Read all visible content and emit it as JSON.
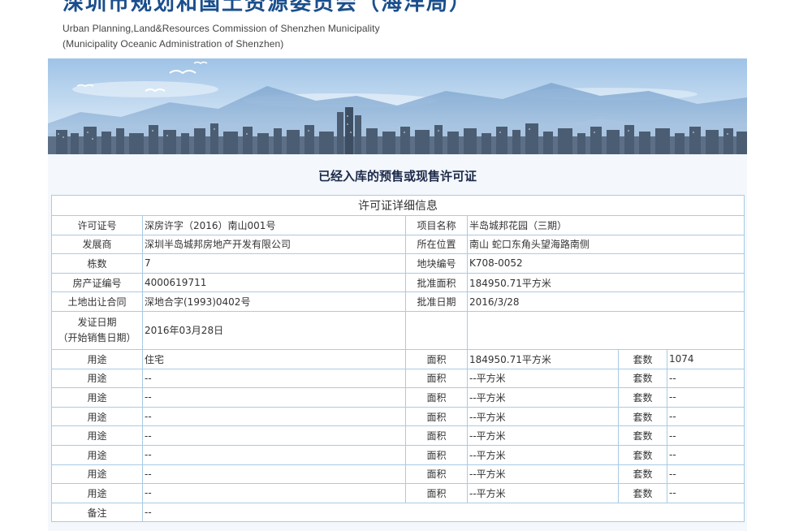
{
  "header": {
    "title": "深圳市规划和国土资源委员会（海洋局）",
    "subtitle_en_line1": "Urban Planning,Land&Resources Commission of Shenzhen Municipality",
    "subtitle_en_line2": "(Municipality Oceanic Administration of Shenzhen)"
  },
  "page": {
    "heading": "已经入库的预售或现售许可证"
  },
  "table": {
    "caption": "许可证详细信息",
    "permit_no_label": "许可证号",
    "permit_no": "深房许字（2016）南山001号",
    "project_name_label": "项目名称",
    "project_name": "半岛城邦花园（三期）",
    "developer_label": "发展商",
    "developer": "深圳半岛城邦房地产开发有限公司",
    "location_label": "所在位置",
    "location": "南山 蛇口东角头望海路南侧",
    "buildings_label": "栋数",
    "buildings": "7",
    "parcel_no_label": "地块编号",
    "parcel_no": "K708-0052",
    "property_cert_label": "房产证编号",
    "property_cert": "4000619711",
    "approved_area_label": "批准面积",
    "approved_area": "184950.71平方米",
    "land_contract_label": "土地出让合同",
    "land_contract": "深地合字(1993)0402号",
    "approval_date_label": "批准日期",
    "approval_date": "2016/3/28",
    "issue_date_label_line1": "发证日期",
    "issue_date_label_line2": "（开始销售日期）",
    "issue_date": "2016年03月28日",
    "usage_rows": [
      {
        "use_label": "用途",
        "use": "住宅",
        "area_label": "面积",
        "area": "184950.71平方米",
        "units_label": "套数",
        "units": "1074"
      },
      {
        "use_label": "用途",
        "use": "--",
        "area_label": "面积",
        "area": "--平方米",
        "units_label": "套数",
        "units": "--"
      },
      {
        "use_label": "用途",
        "use": "--",
        "area_label": "面积",
        "area": "--平方米",
        "units_label": "套数",
        "units": "--"
      },
      {
        "use_label": "用途",
        "use": "--",
        "area_label": "面积",
        "area": "--平方米",
        "units_label": "套数",
        "units": "--"
      },
      {
        "use_label": "用途",
        "use": "--",
        "area_label": "面积",
        "area": "--平方米",
        "units_label": "套数",
        "units": "--"
      },
      {
        "use_label": "用途",
        "use": "--",
        "area_label": "面积",
        "area": "--平方米",
        "units_label": "套数",
        "units": "--"
      },
      {
        "use_label": "用途",
        "use": "--",
        "area_label": "面积",
        "area": "--平方米",
        "units_label": "套数",
        "units": "--"
      },
      {
        "use_label": "用途",
        "use": "--",
        "area_label": "面积",
        "area": "--平方米",
        "units_label": "套数",
        "units": "--"
      }
    ],
    "remarks_label": "备注",
    "remarks": "--"
  },
  "colors": {
    "title_blue": "#1b4f8c",
    "table_border": "#a9cbe4",
    "content_bg": "#f4f7fb"
  }
}
